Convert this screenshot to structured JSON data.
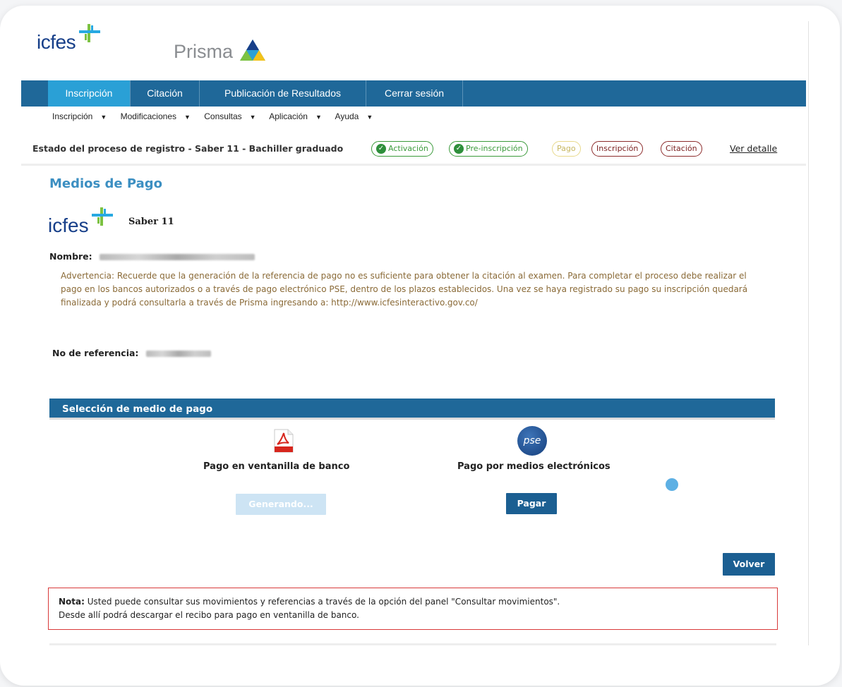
{
  "header": {
    "icfes_logo": "icfes",
    "prisma_logo": "Prisma"
  },
  "nav": {
    "items": [
      {
        "label": "Inscripción",
        "active": true
      },
      {
        "label": "Citación",
        "active": false
      },
      {
        "label": "Publicación de Resultados",
        "active": false
      },
      {
        "label": "Cerrar sesión",
        "active": false
      }
    ]
  },
  "subnav": {
    "items": [
      "Inscripción",
      "Modificaciones",
      "Consultas",
      "Aplicación",
      "Ayuda"
    ]
  },
  "status": {
    "label": "Estado del proceso de registro - Saber 11 - Bachiller graduado",
    "steps": [
      {
        "label": "Activación",
        "state": "done"
      },
      {
        "label": "Pre-inscripción",
        "state": "done"
      },
      {
        "label": "Pago",
        "state": "current"
      },
      {
        "label": "Inscripción",
        "state": "pending"
      },
      {
        "label": "Citación",
        "state": "pending"
      }
    ],
    "detail_link": "Ver detalle"
  },
  "page": {
    "title": "Medios de Pago",
    "exam_name": "Saber 11",
    "nombre_label": "Nombre:",
    "warning": "Advertencia: Recuerde que la generación de la referencia de pago no es suficiente para obtener la citación al examen. Para completar el proceso debe realizar el pago en los bancos autorizados o a través de pago electrónico PSE, dentro de los plazos establecidos. Una vez se haya registrado su pago su inscripción quedará finalizada y podrá consultarla a través de Prisma ingresando a: http://www.icfesinteractivo.gov.co/",
    "ref_label": "No de referencia:"
  },
  "payment": {
    "header": "Selección de medio de pago",
    "bank_label": "Pago en ventanilla de banco",
    "bank_button": "Generando...",
    "electronic_label": "Pago por medios electrónicos",
    "pse_icon_text": "pse",
    "pay_button": "Pagar",
    "back_button": "Volver"
  },
  "note": {
    "prefix": "Nota:",
    "line1": " Usted puede consultar sus movimientos y referencias a través de la opción del panel \"Consultar movimientos\".",
    "line2": "Desde allí podrá descargar el recibo para pago en ventanilla de banco."
  },
  "colors": {
    "nav_bg": "#1f6899",
    "nav_active": "#2aa0d6",
    "title_blue": "#3c8fc2",
    "warning_text": "#8a6a37",
    "note_border": "#d93a3a"
  }
}
